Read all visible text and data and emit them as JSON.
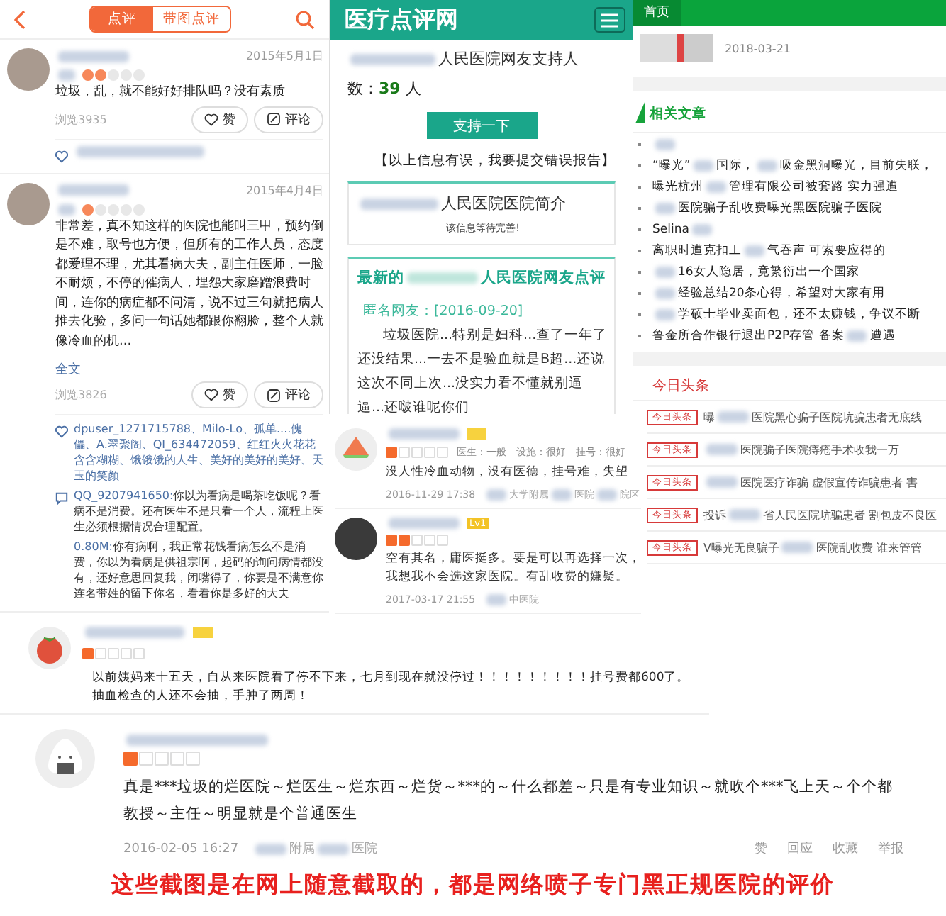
{
  "app_reviews": {
    "tabs": [
      {
        "label": "点评",
        "selected": true
      },
      {
        "label": "带图点评",
        "selected": false
      }
    ],
    "reviews": [
      {
        "date": "2015年5月1日",
        "stars": 2,
        "text": "垃圾，乱，就不能好好排队吗？没有素质",
        "views": "浏览3935",
        "like": "赞",
        "comment": "评论"
      },
      {
        "date": "2015年4月4日",
        "stars": 1,
        "text": "非常差，真不知这样的医院也能叫三甲，预约倒是不难，取号也方便，但所有的工作人员，态度都爱理不理，尤其看病大夫，副主任医师，一脸不耐烦，不停的催病人，埋怨大家磨蹭浪费时间，连你的病症都不问清，说不过三句就把病人推去化验，多问一句话她都跟你翻脸，整个人就像冷血的机...",
        "more": "全文",
        "views": "浏览3826",
        "like": "赞",
        "comment": "评论",
        "likers": "dpuser_1271715788、Milo-Lo、孤单....傀儡、A.翠聚阁、QI_634472059、红红火火花花含含糊糊、饿饿饿的人生、美好的美好的美好、天玉的笑颜",
        "comments": [
          {
            "author": "QQ_9207941650:",
            "text": "你以为看病是喝茶吃饭呢？看病不是消费。还有医生不是只看一个人，流程上医生必须根据情况合理配置。"
          },
          {
            "author": "0.80M:",
            "text": "你有病啊，我正常花钱看病怎么不是消费，你以为看病是供祖宗啊，起码的询问病情都没有，还好意思回复我，闭嘴得了，你要是不满意你连名带姓的留下你名，看看你是多好的大夫"
          }
        ]
      }
    ]
  },
  "hospital_site": {
    "title": "医疗点评网",
    "supporters_label": "人民医院网友支持人",
    "count_prefix": "数：",
    "count": "39",
    "count_suffix": "人",
    "support_button": "支持一下",
    "error_report": "【以上信息有误，我要提交错误报告】",
    "intro_title": "人民医院医院简介",
    "intro_text": "该信息等待完善!",
    "latest_prefix": "最新的",
    "latest_suffix": "人民医院网友点评",
    "review_author": "匿名网友：[2016-09-20]",
    "review_text": "垃圾医院...特别是妇科...查了一年了还没结果...一去不是验血就是B超...还说这次不同上次...没实力看不懂就别逼逼...还啵谁呢你们"
  },
  "news_site": {
    "nav_tab": "首页",
    "date": "2018-03-21",
    "section": "相关文章",
    "articles": [
      [
        {
          "kind": "blur"
        }
      ],
      [
        {
          "kind": "text",
          "text": "“曝光”"
        },
        {
          "kind": "blur"
        },
        {
          "kind": "text",
          "text": "国际，"
        },
        {
          "kind": "blur"
        },
        {
          "kind": "text",
          "text": "吸金黑洞曝光，目前失联，"
        }
      ],
      [
        {
          "kind": "text",
          "text": "曝光杭州"
        },
        {
          "kind": "blur"
        },
        {
          "kind": "text",
          "text": "管理有限公司被套路 实力强遭"
        }
      ],
      [
        {
          "kind": "blur"
        },
        {
          "kind": "text",
          "text": "医院骗子乱收费曝光黑医院骗子医院"
        }
      ],
      [
        {
          "kind": "text",
          "text": "Selina"
        },
        {
          "kind": "blur"
        }
      ],
      [
        {
          "kind": "text",
          "text": "离职时遭克扣工"
        },
        {
          "kind": "blur"
        },
        {
          "kind": "text",
          "text": "气吞声 可索要应得的"
        }
      ],
      [
        {
          "kind": "blur"
        },
        {
          "kind": "text",
          "text": "16女人隐居，竟繁衍出一个国家"
        }
      ],
      [
        {
          "kind": "blur"
        },
        {
          "kind": "text",
          "text": "经验总结20条心得，希望对大家有用"
        }
      ],
      [
        {
          "kind": "blur"
        },
        {
          "kind": "text",
          "text": "学硕士毕业卖面包，还不太赚钱，争议不断"
        }
      ],
      [
        {
          "kind": "text",
          "text": "鲁金所合作银行退出P2P存管 备案"
        },
        {
          "kind": "blur"
        },
        {
          "kind": "text",
          "text": "遭遇"
        }
      ]
    ],
    "headlines_title": "今日头条",
    "headlines": [
      {
        "tag": "今日头条",
        "parts": [
          {
            "kind": "text",
            "text": "曝"
          },
          {
            "kind": "blur"
          },
          {
            "kind": "text",
            "text": "医院黑心骗子医院坑骗患者无底线"
          }
        ]
      },
      {
        "tag": "今日头条",
        "parts": [
          {
            "kind": "blur"
          },
          {
            "kind": "text",
            "text": "医院骗子医院痔疮手术收我一万"
          }
        ]
      },
      {
        "tag": "今日头条",
        "parts": [
          {
            "kind": "blur"
          },
          {
            "kind": "text",
            "text": "医院医疗诈骗 虚假宣传诈骗患者 害"
          }
        ]
      },
      {
        "tag": "今日头条",
        "parts": [
          {
            "kind": "text",
            "text": "投诉"
          },
          {
            "kind": "blur"
          },
          {
            "kind": "text",
            "text": "省人民医院坑骗患者 割包皮不良医"
          }
        ]
      },
      {
        "tag": "今日头条",
        "parts": [
          {
            "kind": "text",
            "text": "V曝光无良骗子"
          },
          {
            "kind": "blur"
          },
          {
            "kind": "text",
            "text": "医院乱收费 谁来管管"
          }
        ]
      }
    ]
  },
  "card_reviews": [
    {
      "kind": "watermelon",
      "stars": 1,
      "scores": "医生：一般　设施：很好　挂号：很好",
      "text": "没人性冷血动物，没有医德，挂号难，失望",
      "date": "2016-11-29 17:38",
      "source": [
        {
          "kind": "blur"
        },
        {
          "kind": "text",
          "text": "大学附属"
        },
        {
          "kind": "blur"
        },
        {
          "kind": "text",
          "text": "医院"
        },
        {
          "kind": "blur"
        },
        {
          "kind": "text",
          "text": "院区"
        }
      ]
    },
    {
      "kind": "photo",
      "badge": "Lv1",
      "stars": 2,
      "text": "空有其名，庸医挺多。要是可以再选择一次，我想我不会选这家医院。有乱收费的嫌疑。",
      "date": "2017-03-17 21:55",
      "source": [
        {
          "kind": "blur"
        },
        {
          "kind": "text",
          "text": "中医院"
        }
      ]
    }
  ],
  "tomato_review": {
    "stars": 1,
    "text": "以前姨妈来十五天，自从来医院看了停不下来，七月到现在就没停过！！！！！！！！！挂号费都600了。抽血检查的人还不会抽，手肿了两周！"
  },
  "bottom_review": {
    "stars": 1,
    "text": "真是***垃圾的烂医院～烂医生～烂东西～烂货～***的～什么都差～只是有专业知识～就吹个***飞上天～个个都教授～主任～明显就是个普通医生",
    "date": "2016-02-05 16:27",
    "source": [
      {
        "kind": "blur"
      },
      {
        "kind": "text",
        "text": "附属"
      },
      {
        "kind": "blur"
      },
      {
        "kind": "text",
        "text": "医院"
      }
    ],
    "actions": [
      "赞",
      "回应",
      "收藏",
      "举报"
    ]
  },
  "caption": "这些截图是在网上随意截取的，都是网络喷子专门黑正规医院的评价"
}
